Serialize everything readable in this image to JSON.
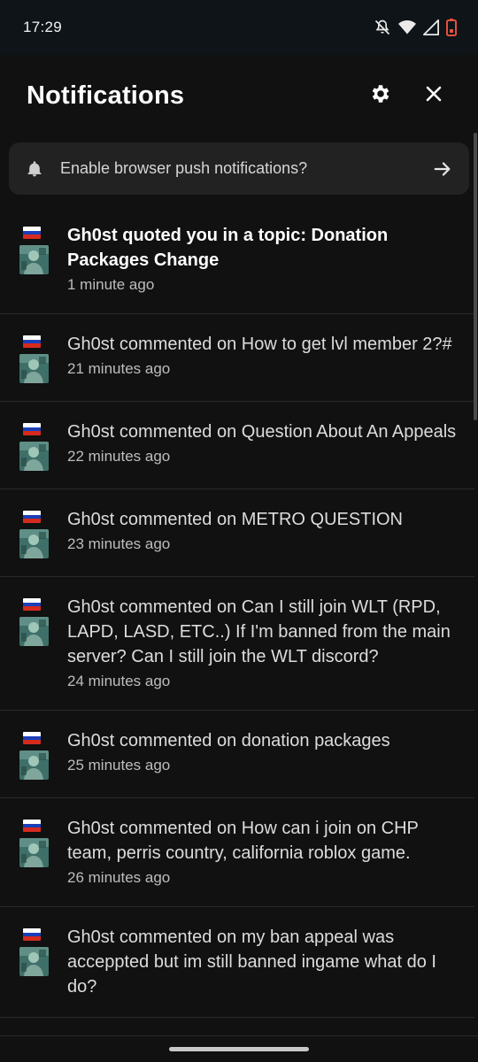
{
  "status_bar": {
    "time": "17:29"
  },
  "header": {
    "title": "Notifications"
  },
  "push_banner": {
    "text": "Enable browser push notifications?"
  },
  "notifications": [
    {
      "text": "Gh0st quoted you in a topic: Donation Packages Change",
      "time": "1 minute ago",
      "unread": true
    },
    {
      "text": "Gh0st commented on How to get lvl member 2?#",
      "time": "21 minutes ago",
      "unread": false
    },
    {
      "text": "Gh0st commented on Question About An Appeals",
      "time": "22 minutes ago",
      "unread": false
    },
    {
      "text": "Gh0st commented on METRO QUESTION",
      "time": "23 minutes ago",
      "unread": false
    },
    {
      "text": "Gh0st commented on Can I still join WLT (RPD, LAPD, LASD, ETC..) If I'm banned from the main server? Can I still join the WLT discord?",
      "time": "24 minutes ago",
      "unread": false
    },
    {
      "text": "Gh0st commented on donation packages",
      "time": "25 minutes ago",
      "unread": false
    },
    {
      "text": "Gh0st commented on How can i join on CHP team, perris country, california roblox game.",
      "time": "26 minutes ago",
      "unread": false
    },
    {
      "text": "Gh0st commented on my ban appeal was acceppted but im still banned ingame what do I do?",
      "time": "",
      "unread": false
    }
  ]
}
